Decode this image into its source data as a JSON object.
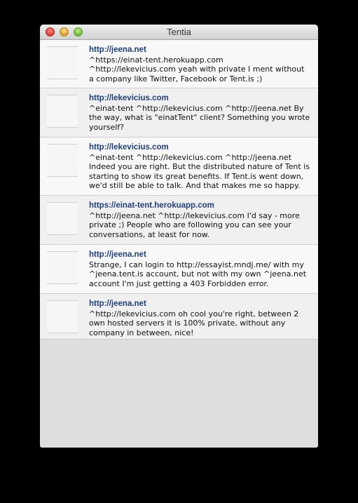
{
  "window": {
    "title": "Tentia"
  },
  "posts": [
    {
      "author": "http://jeena.net",
      "text": "^https://einat-tent.herokuapp.com ^http://lekevicius.com yeah with private I ment without a company like Twitter, Facebook or Tent.is ;)"
    },
    {
      "author": "http://lekevicius.com",
      "text": "^einat-tent ^http://lekevicius.com ^http://jeena.net By the way, what is \"einatTent\" client? Something you wrote yourself?"
    },
    {
      "author": "http://lekevicius.com",
      "text": "^einat-tent ^http://lekevicius.com ^http://jeena.net Indeed you are right. But the distributed nature of Tent is starting to show its great benefits. If Tent.is went down, we'd still be able to talk. And that makes me so happy."
    },
    {
      "author": "https://einat-tent.herokuapp.com",
      "text": "^http://jeena.net ^http://lekevicius.com I'd say - more private ;) People who are following you can see your conversations, at least for now."
    },
    {
      "author": "http://jeena.net",
      "text": "Strange, I can login to http://essayist.mndj.me/ with my ^jeena.tent.is account, but not with my own ^jeena.net account I'm just getting a 403 Forbidden error."
    },
    {
      "author": "http://jeena.net",
      "text": "^http://lekevicius.com oh cool you're right, between 2 own hosted servers it is 100% private, without any company in between, nice!"
    }
  ]
}
